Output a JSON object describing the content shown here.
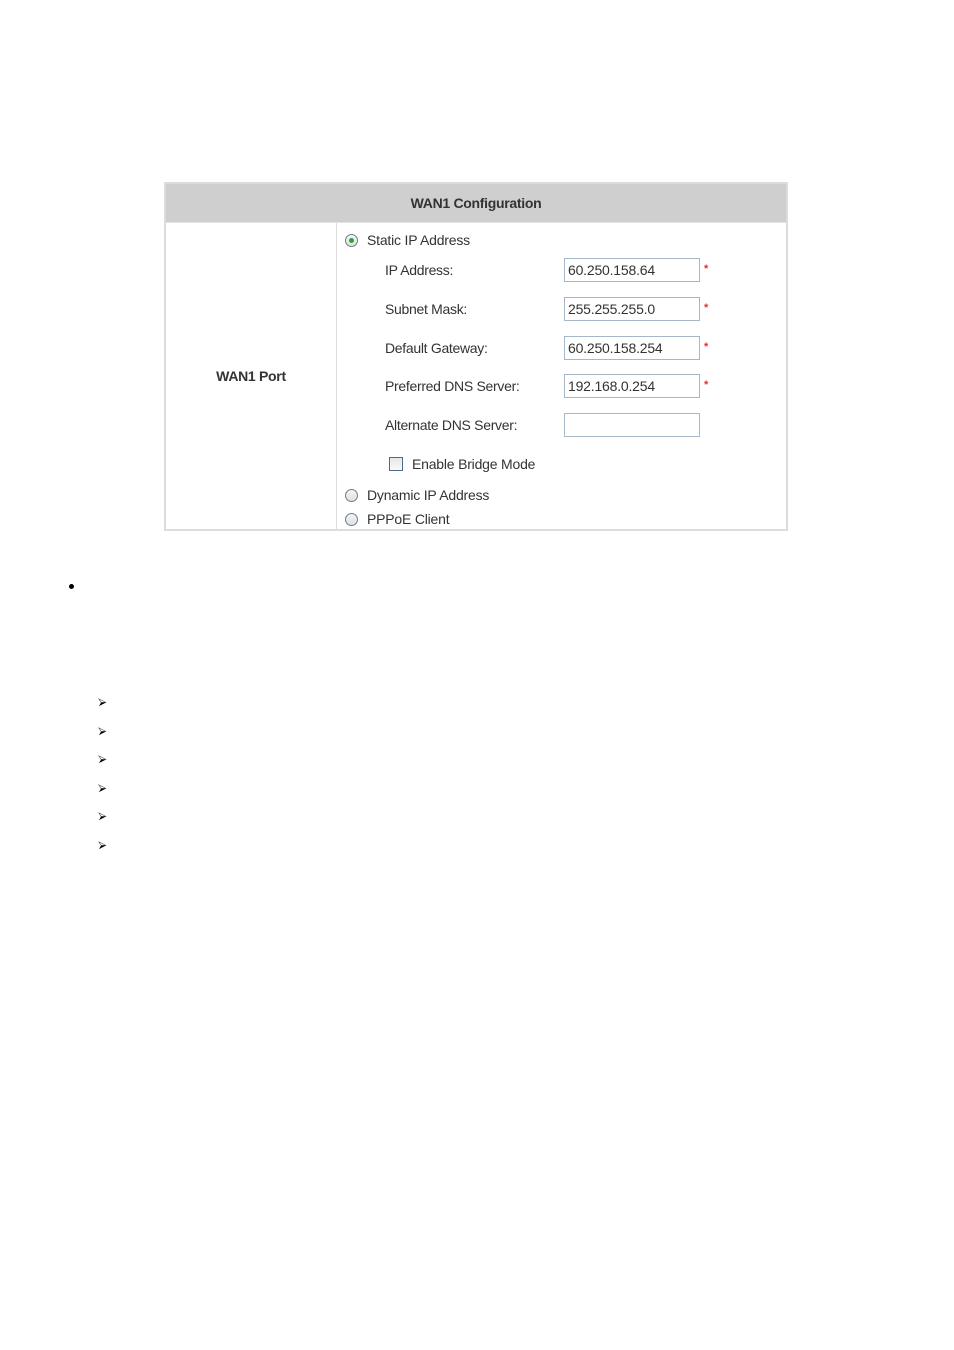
{
  "wan_config": {
    "title": "WAN1 Configuration",
    "port_label": "WAN1 Port",
    "modes": [
      {
        "label": "Static IP Address",
        "selected": true
      },
      {
        "label": "Dynamic IP Address",
        "selected": false
      },
      {
        "label": "PPPoE Client",
        "selected": false
      }
    ],
    "fields": [
      {
        "label": "IP Address:",
        "value": "60.250.158.64",
        "required": true
      },
      {
        "label": "Subnet Mask:",
        "value": "255.255.255.0",
        "required": true
      },
      {
        "label": "Default Gateway:",
        "value": "60.250.158.254",
        "required": true
      },
      {
        "label": "Preferred DNS Server:",
        "value": "192.168.0.254",
        "required": true
      },
      {
        "label": "Alternate DNS Server:",
        "value": "",
        "required": false
      }
    ],
    "required_marker": "*",
    "bridge_mode": {
      "label": "Enable Bridge Mode",
      "checked": false
    }
  },
  "document": {
    "bullet_icon": "round-bullet",
    "arrow_bullet_icon": "arrowhead-bullet",
    "arrow_bullet_count": 6
  }
}
